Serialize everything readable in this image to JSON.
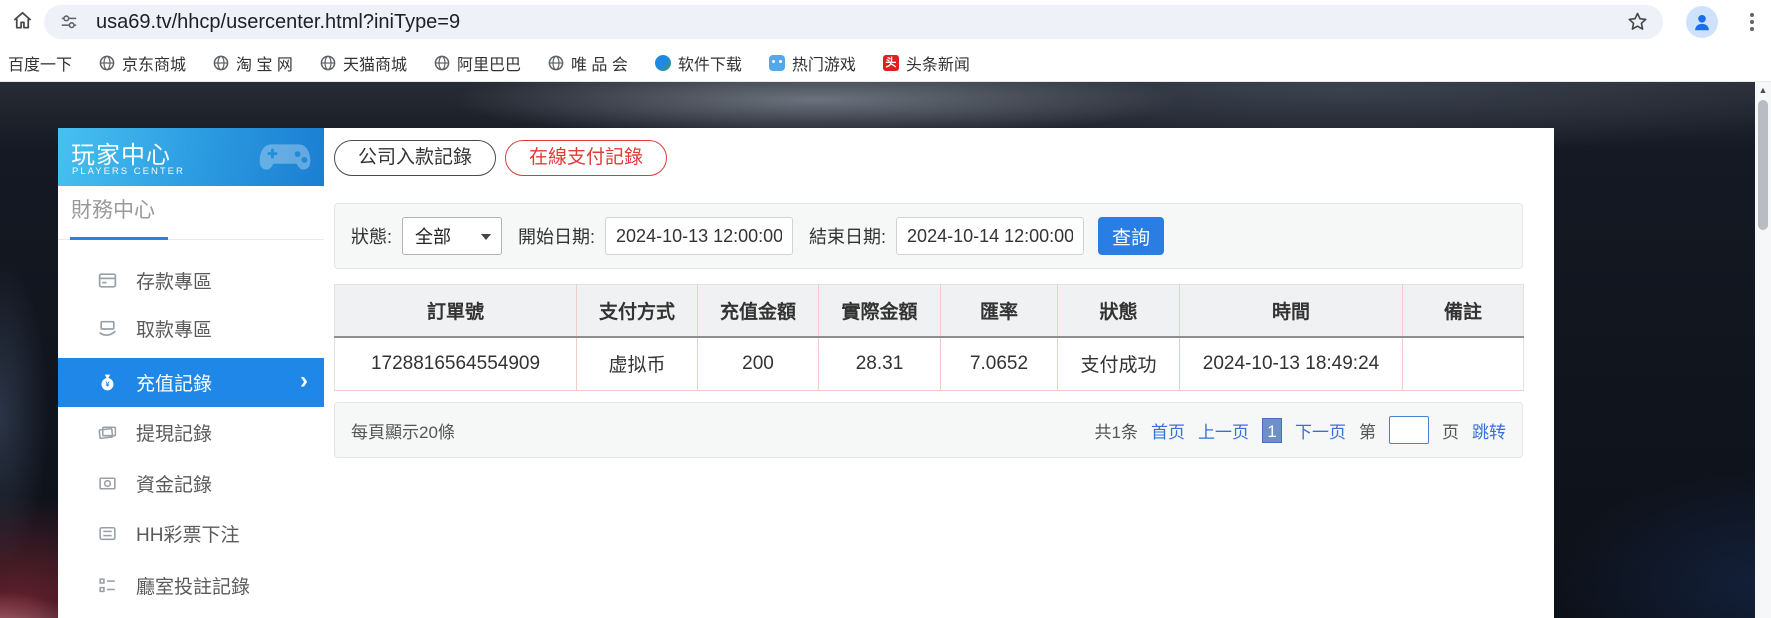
{
  "browser": {
    "url": "usa69.tv/hhcp/usercenter.html?iniType=9",
    "bookmarks": [
      "百度一下",
      "京东商城",
      "淘 宝 网",
      "天猫商城",
      "阿里巴巴",
      "唯 品 会",
      "软件下载",
      "热门游戏",
      "头条新闻"
    ],
    "toutiao_badge": "头"
  },
  "sidebar": {
    "title": "玩家中心",
    "subtitle": "PLAYERS CENTER",
    "section": "財務中心",
    "items": [
      {
        "label": "存款專區"
      },
      {
        "label": "取款專區"
      },
      {
        "label": "充值記錄"
      },
      {
        "label": "提現記錄"
      },
      {
        "label": "資金記錄"
      },
      {
        "label": "HH彩票下注"
      },
      {
        "label": "廳室投註記錄"
      }
    ]
  },
  "main": {
    "tabs": [
      {
        "label": "公司入款記錄"
      },
      {
        "label": "在線支付記錄"
      }
    ],
    "filter": {
      "status_label": "狀態:",
      "status_value": "全部",
      "start_label": "開始日期:",
      "start_value": "2024-10-13 12:00:00",
      "end_label": "結束日期:",
      "end_value": "2024-10-14 12:00:00",
      "search_label": "查詢"
    },
    "table": {
      "headers": [
        "訂單號",
        "支付方式",
        "充值金額",
        "實際金額",
        "匯率",
        "狀態",
        "時間",
        "備註"
      ],
      "row": [
        "1728816564554909",
        "虚拟币",
        "200",
        "28.31",
        "7.0652",
        "支付成功",
        "2024-10-13 18:49:24",
        ""
      ]
    },
    "pagination": {
      "page_size_text": "每頁顯示20條",
      "total_text": "共1条",
      "first": "首页",
      "prev": "上一页",
      "current_page": "1",
      "next": "下一页",
      "jump_prefix": "第",
      "jump_suffix": "页",
      "jump_action": "跳转"
    }
  },
  "colors": {
    "sidebar_active_blue": "#1f87e8",
    "tab_active_red": "#e03b3b",
    "search_button_blue": "#2a7de2",
    "link_blue": "#3a6fd8",
    "banner_gradient_start": "#47c0f1",
    "banner_gradient_end": "#1b7ed2",
    "table_border_pink": "#f3ccc6"
  }
}
